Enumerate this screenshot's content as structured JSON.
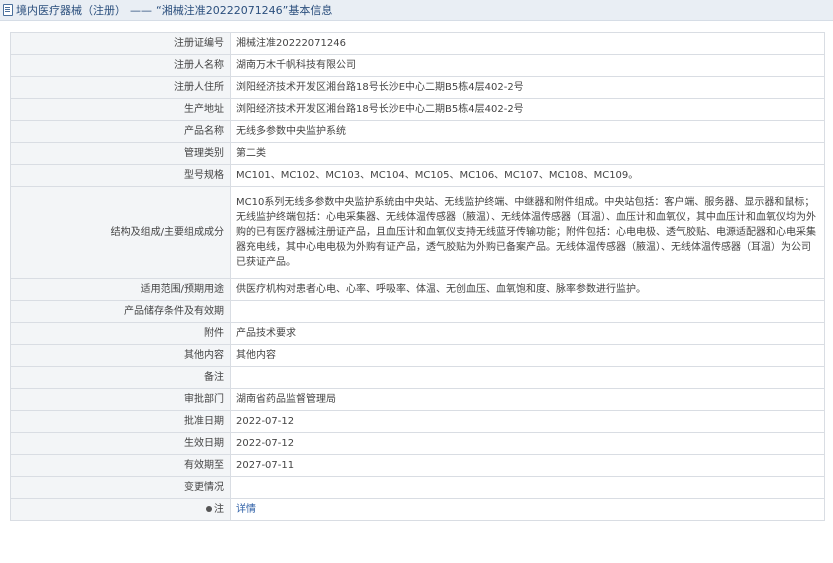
{
  "header": {
    "category": "境内医疗器械（注册）",
    "separator": "——",
    "entry_title": "“湘械注准20222071246”基本信息"
  },
  "rows": [
    {
      "label": "注册证编号",
      "value": "湘械注准20222071246"
    },
    {
      "label": "注册人名称",
      "value": "湖南万木千帆科技有限公司"
    },
    {
      "label": "注册人住所",
      "value": "浏阳经济技术开发区湘台路18号长沙E中心二期B5栋4层402-2号"
    },
    {
      "label": "生产地址",
      "value": "浏阳经济技术开发区湘台路18号长沙E中心二期B5栋4层402-2号"
    },
    {
      "label": "产品名称",
      "value": "无线多参数中央监护系统"
    },
    {
      "label": "管理类别",
      "value": "第二类"
    },
    {
      "label": "型号规格",
      "value": "MC101、MC102、MC103、MC104、MC105、MC106、MC107、MC108、MC109。"
    },
    {
      "label": "结构及组成/主要组成成分",
      "value": "MC10系列无线多参数中央监护系统由中央站、无线监护终端、中继器和附件组成。中央站包括：客户端、服务器、显示器和鼠标；无线监护终端包括：心电采集器、无线体温传感器（腋温）、无线体温传感器（耳温）、血压计和血氧仪，其中血压计和血氧仪均为外购的已有医疗器械注册证产品，且血压计和血氧仪支持无线蓝牙传输功能；附件包括：心电电极、透气胶贴、电源适配器和心电采集器充电线，其中心电电极为外购有证产品，透气胶贴为外购已备案产品。无线体温传感器（腋温）、无线体温传感器（耳温）为公司已获证产品。"
    },
    {
      "label": "适用范围/预期用途",
      "value": "供医疗机构对患者心电、心率、呼吸率、体温、无创血压、血氧饱和度、脉率参数进行监护。"
    },
    {
      "label": "产品储存条件及有效期",
      "value": ""
    },
    {
      "label": "附件",
      "value": "产品技术要求"
    },
    {
      "label": "其他内容",
      "value": "其他内容"
    },
    {
      "label": "备注",
      "value": ""
    },
    {
      "label": "审批部门",
      "value": "湖南省药品监督管理局"
    },
    {
      "label": "批准日期",
      "value": "2022-07-12"
    },
    {
      "label": "生效日期",
      "value": "2022-07-12"
    },
    {
      "label": "有效期至",
      "value": "2027-07-11"
    },
    {
      "label": "变更情况",
      "value": ""
    }
  ],
  "note_row": {
    "label": "注",
    "link_text": "详情",
    "icon": "pin-icon"
  }
}
